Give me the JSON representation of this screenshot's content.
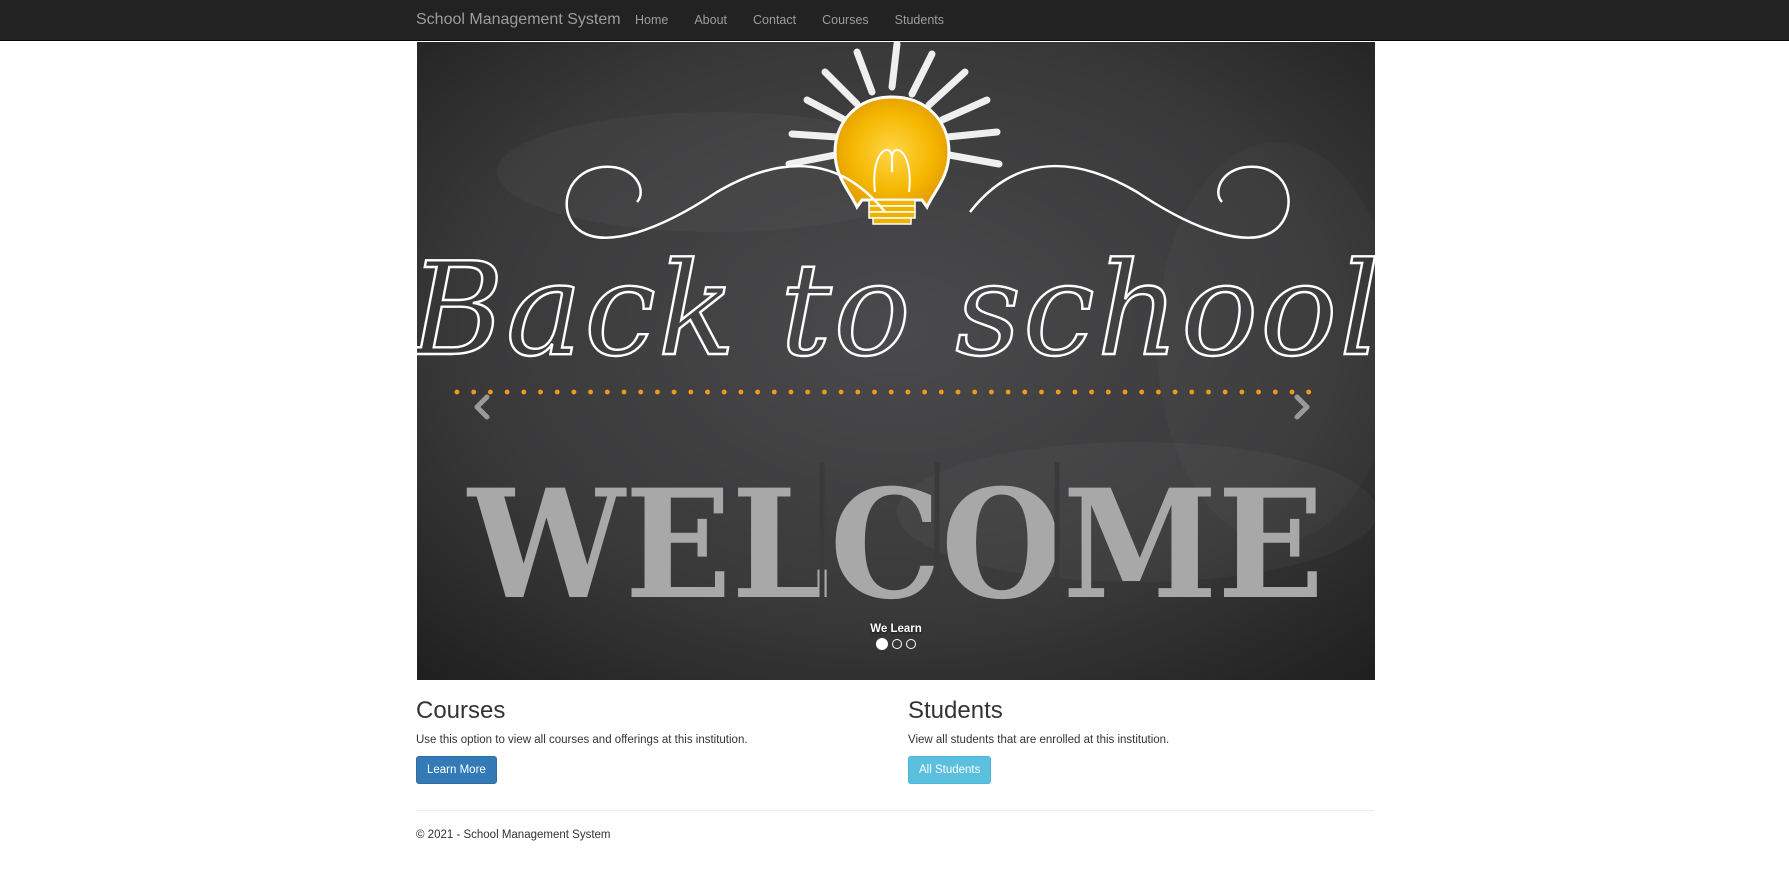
{
  "navbar": {
    "brand": "School Management System",
    "links": [
      {
        "label": "Home"
      },
      {
        "label": "About"
      },
      {
        "label": "Contact"
      },
      {
        "label": "Courses"
      },
      {
        "label": "Students"
      }
    ],
    "background": "#222222",
    "link_color": "#9d9d9d"
  },
  "carousel": {
    "image": {
      "heading": "Back to school",
      "subheading": "WELCOME",
      "icon": "lightbulb-icon"
    },
    "caption": "We Learn",
    "slide_count": 3,
    "active_index": 0,
    "prev_icon": "chevron-left-icon",
    "next_icon": "chevron-right-icon"
  },
  "sections": {
    "courses": {
      "title": "Courses",
      "description": "Use this option to view all courses and offerings at this institution.",
      "button_label": "Learn More",
      "button_color": "#337ab7"
    },
    "students": {
      "title": "Students",
      "description": "View all students that are enrolled at this institution.",
      "button_label": "All Students",
      "button_color": "#5bc0de"
    }
  },
  "footer": {
    "text": "© 2021 - School Management System"
  }
}
